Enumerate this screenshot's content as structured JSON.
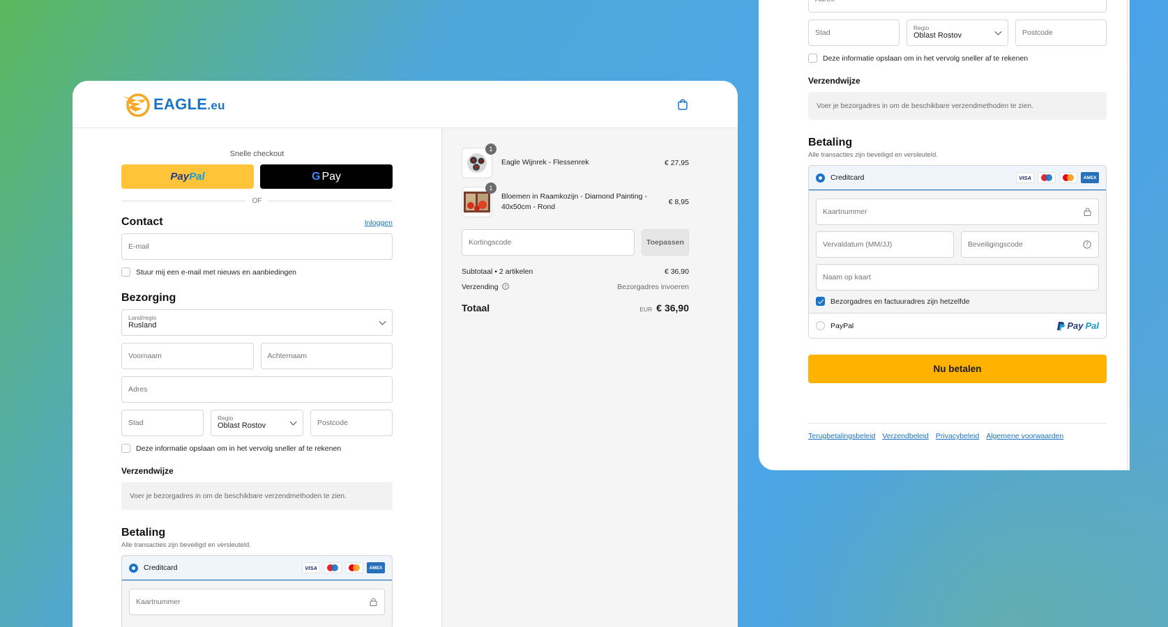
{
  "brand": {
    "name": "EAGLE",
    "suffix": ".eu"
  },
  "express": {
    "label": "Snelle checkout",
    "paypal_a": "Pay",
    "paypal_b": "Pal",
    "gpay_g": "G",
    "gpay_text": "Pay",
    "or": "OF"
  },
  "contact": {
    "title": "Contact",
    "login": "Inloggen",
    "email_placeholder": "E-mail",
    "newsletter": "Stuur mij een e-mail met nieuws en aanbiedingen"
  },
  "delivery": {
    "title": "Bezorging",
    "country_label": "Land/regio",
    "country_value": "Rusland",
    "first_name": "Voornaam",
    "last_name": "Achternaam",
    "address": "Adres",
    "city": "Stad",
    "region_label": "Regio",
    "region_value": "Oblast Rostov",
    "postcode": "Postcode",
    "save_info": "Deze informatie opslaan om in het vervolg sneller af te rekenen"
  },
  "shipping": {
    "title": "Verzendwijze",
    "notice": "Voer je bezorgadres in om de beschikbare verzendmethoden te zien."
  },
  "payment": {
    "title": "Betaling",
    "subtitle": "Alle transacties zijn beveiligd en versleuteld.",
    "creditcard": "Creditcard",
    "card_brands": [
      "VISA",
      "Maestro",
      "Mastercard",
      "AMEX"
    ],
    "card_number": "Kaartnummer",
    "expiry": "Vervaldatum (MM/JJ)",
    "security_code": "Beveiligingscode",
    "name_on_card": "Naam op kaart",
    "same_address": "Bezorgadres en factuuradres zijn hetzelfde",
    "paypal": "PayPal",
    "paypal_logo_a": "Pay",
    "paypal_logo_b": "Pal"
  },
  "summary": {
    "items": [
      {
        "name": "Eagle Wijnrek - Flessenrek",
        "price": "€ 27,95",
        "qty": "1"
      },
      {
        "name": "Bloemen in Raamkozijn - Diamond Painting - 40x50cm - Rond",
        "price": "€ 8,95",
        "qty": "1"
      }
    ],
    "discount_placeholder": "Kortingscode",
    "apply": "Toepassen",
    "subtotal_label": "Subtotaal • 2 artikelen",
    "subtotal_value": "€ 36,90",
    "shipping_label": "Verzending",
    "shipping_value": "Bezorgadres invoeren",
    "total_label": "Totaal",
    "total_currency": "EUR",
    "total_value": "€ 36,90"
  },
  "checkout": {
    "pay_now": "Nu betalen",
    "links": [
      "Terugbetalingsbeleid",
      "Verzendbeleid",
      "Privacybeleid",
      "Algemene voorwaarden"
    ]
  },
  "colors": {
    "accent": "#1b73c8",
    "pay_button": "#ffb200",
    "paypal_button": "#ffc439"
  }
}
